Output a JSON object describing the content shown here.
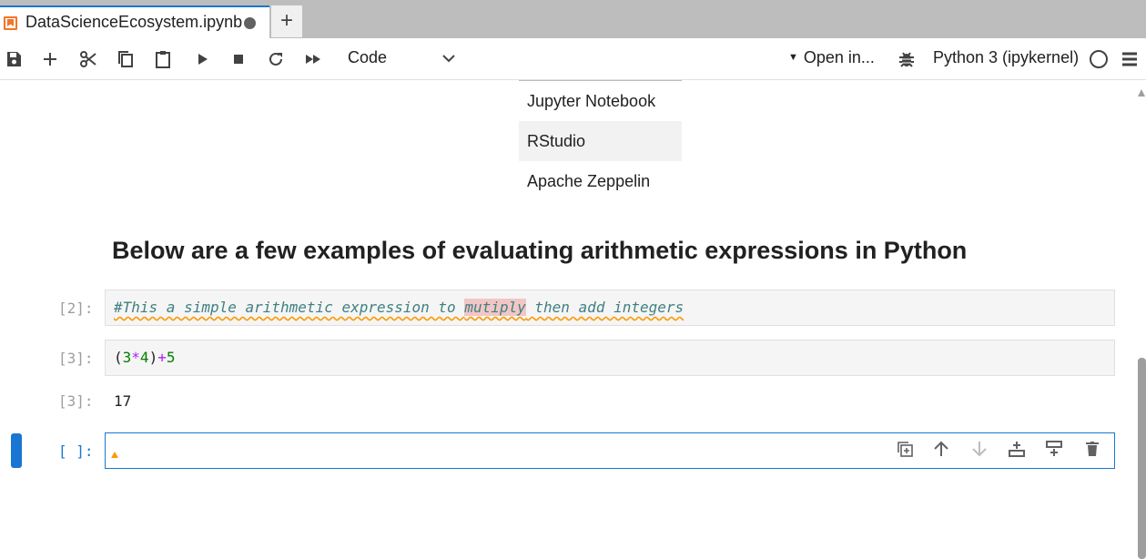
{
  "tab": {
    "title": "DataScienceEcosystem.ipynb",
    "icon": "notebook-icon",
    "accent": "#1976d2",
    "icon_color": "#f37626",
    "add_label": "+"
  },
  "toolbar": {
    "cell_type": "Code",
    "open_in_label": "Open in...",
    "kernel_name": "Python 3 (ipykernel)",
    "icons": [
      "save-icon",
      "add-cell-icon",
      "cut-icon",
      "copy-icon",
      "paste-icon",
      "run-icon",
      "stop-icon",
      "restart-icon",
      "run-all-icon",
      "bug-icon",
      "menu-icon"
    ]
  },
  "notebook": {
    "tools": [
      "Jupyter Notebook",
      "RStudio",
      "Apache Zeppelin"
    ],
    "heading": "Below are a few examples of evaluating arithmetic expressions in Python",
    "cells": [
      {
        "prompt": "[2]:",
        "comment_before": "#This a simple arithmetic expression to ",
        "comment_highlight": "mutiply",
        "comment_after": " then add integers"
      },
      {
        "prompt": "[3]:",
        "code": {
          "open": "(",
          "a": "3",
          "mul": "*",
          "b": "4",
          "close": ")",
          "add": "+",
          "c": "5"
        },
        "output_prompt": "[3]:",
        "output": "17"
      },
      {
        "prompt": "[ ]:",
        "code": ""
      }
    ],
    "cell_tools": [
      "duplicate-icon",
      "move-up-icon",
      "move-down-icon",
      "insert-above-icon",
      "insert-below-icon",
      "delete-icon"
    ]
  }
}
